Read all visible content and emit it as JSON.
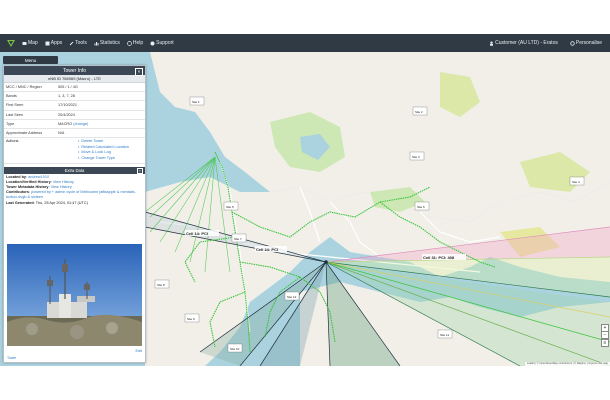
{
  "navbar": {
    "items": [
      "Map",
      "Apps",
      "Tools",
      "Statistics",
      "Help",
      "Support"
    ],
    "account": "Customer (AU LTD) - Eratos",
    "settings": "Personalise"
  },
  "menu_tab": "Menu",
  "panel": {
    "title": "Tower Info",
    "subtitle": "eNB ID 766969 (Macro) - LTE",
    "rows": [
      {
        "k": "MCC / MNC / Region",
        "v": "505 / 1 / 4G"
      },
      {
        "k": "Bands",
        "v": "1, 3, 7, 28"
      },
      {
        "k": "First Seen",
        "v": "17/10/2021"
      },
      {
        "k": "Last Seen",
        "v": "20/4/2024"
      },
      {
        "k": "Type",
        "v": "MACRO",
        "link": "(change)"
      },
      {
        "k": "Approximate Address",
        "v": "N/A"
      }
    ],
    "actions_label": "Actions",
    "actions": [
      "Delete Tower",
      "Related Calculated Location",
      "Move & Lock Log",
      "Change Tower Type"
    ],
    "extra_title": "Extra Data",
    "meta": [
      {
        "k": "Located by",
        "v": "andrew1010"
      },
      {
        "k": "Location/Verified History",
        "v": "View History"
      },
      {
        "k": "Tower Metadata History",
        "v": "View History"
      },
      {
        "k": "Contributors",
        "v": "powered by + admin cycle of Melbourne jaffaapple & mentalis, tuxbox.dvgb & sixteen"
      },
      {
        "k": "Last Generated",
        "v": "Thu, 25 Apr 2024, 01:47 (UTC)"
      }
    ],
    "edit": "Edit",
    "footer": "Tower"
  },
  "map": {
    "cell_labels": [
      "Cell 14: PCI",
      "Cell 24: PCI",
      "Cell 31: PCI: 408"
    ],
    "sites": [
      "Site 1",
      "Site 2",
      "Site 3",
      "Site 4",
      "Site 5",
      "Site 6",
      "Site 7",
      "Site 8",
      "Site 9",
      "Site 10",
      "Site 11",
      "Site 12"
    ]
  },
  "attribution": "Leaflet | © OpenStreetMap contributors | © Mapbox | Improve this map",
  "colors": {
    "navbar": "#2f3a45",
    "land": "#f2efe9",
    "water": "#aad3df",
    "park": "#cde8b4",
    "route": "#39c43a"
  }
}
